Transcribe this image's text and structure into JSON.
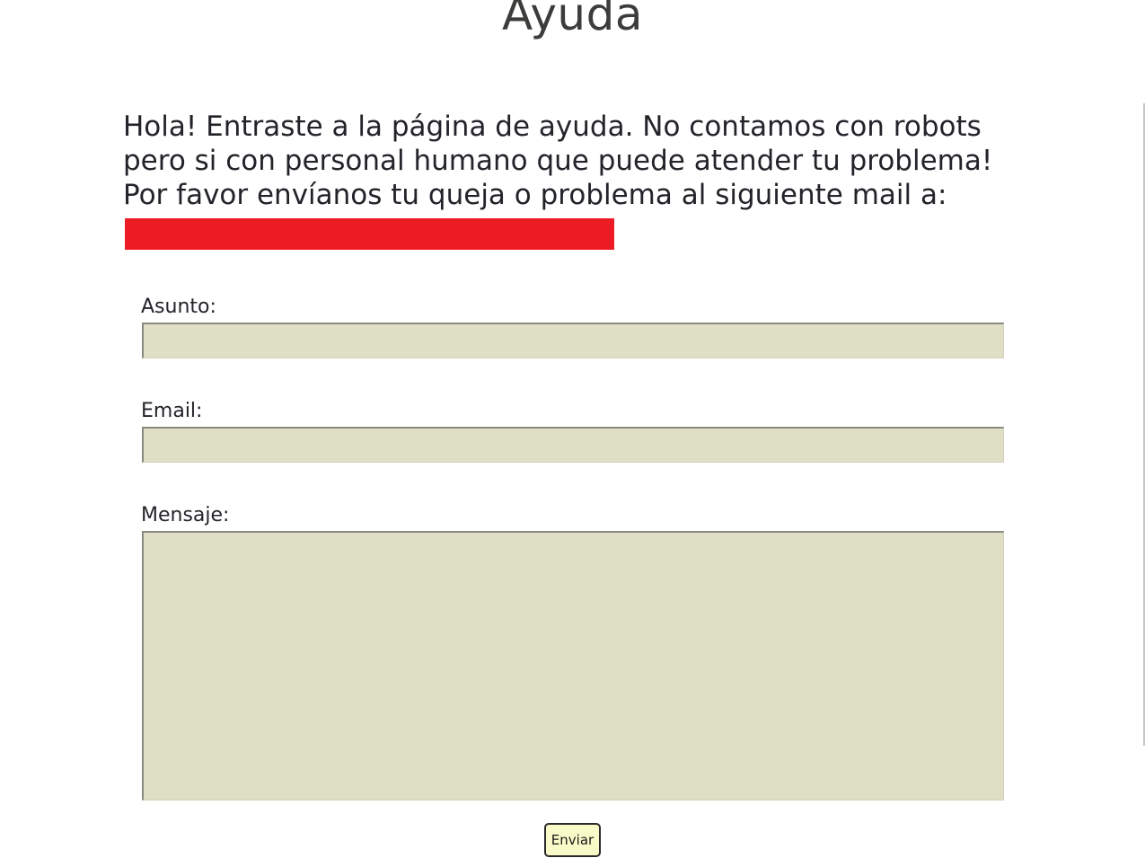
{
  "page": {
    "title": "Ayuda",
    "intro": "Hola! Entraste a la página de ayuda. No contamos con robots pero si con personal humano que puede atender tu problema! Por favor envíanos tu queja o problema al siguiente mail a:"
  },
  "form": {
    "subject_label": "Asunto:",
    "subject_value": "",
    "email_label": "Email:",
    "email_value": "",
    "message_label": "Mensaje:",
    "message_value": "",
    "submit_label": "Enviar"
  },
  "colors": {
    "input_background": "#dfdfc6",
    "button_background": "#fafac8",
    "redaction": "#ed1c24"
  }
}
